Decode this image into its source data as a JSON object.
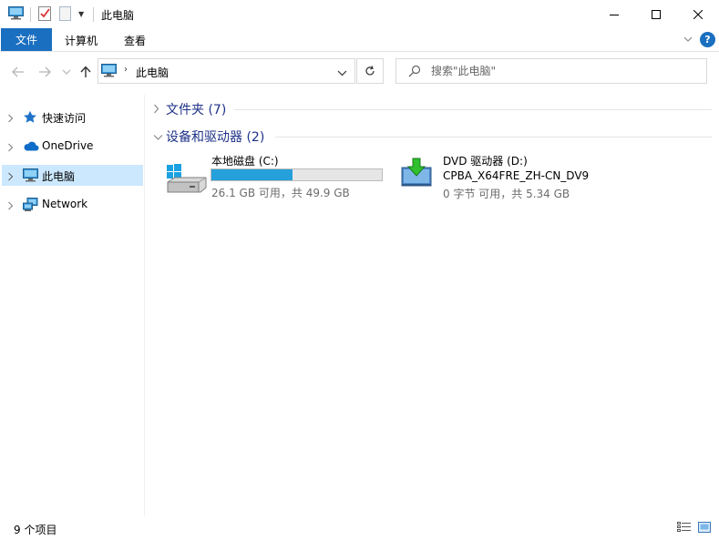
{
  "window": {
    "title": "此电脑"
  },
  "ribbon": {
    "tabs": [
      {
        "label": "文件"
      },
      {
        "label": "计算机"
      },
      {
        "label": "查看"
      }
    ],
    "help": "?"
  },
  "address": {
    "path": "此电脑",
    "separator": "›"
  },
  "search": {
    "placeholder": "搜索\"此电脑\""
  },
  "nav": {
    "items": [
      {
        "label": "快速访问",
        "icon": "star-icon"
      },
      {
        "label": "OneDrive",
        "icon": "cloud-icon"
      },
      {
        "label": "此电脑",
        "icon": "computer-icon",
        "selected": true
      },
      {
        "label": "Network",
        "icon": "network-icon"
      }
    ]
  },
  "content": {
    "groups": [
      {
        "title": "文件夹 (7)",
        "expanded": false
      },
      {
        "title": "设备和驱动器 (2)",
        "expanded": true
      }
    ],
    "drives": [
      {
        "name": "本地磁盘 (C:)",
        "space": "26.1 GB 可用，共 49.9 GB",
        "used_fraction": 0.477,
        "icon": "windows-drive-icon"
      },
      {
        "name": "DVD 驱动器 (D:)",
        "label": "CPBA_X64FRE_ZH-CN_DV9",
        "space": "0 字节 可用，共 5.34 GB",
        "icon": "dvd-drive-icon"
      }
    ]
  },
  "status": {
    "count": "9 个项目"
  },
  "colors": {
    "accent": "#1a6fc0",
    "selection": "#cce8ff",
    "progress": "#26a0da",
    "group_title": "#1e3287"
  }
}
